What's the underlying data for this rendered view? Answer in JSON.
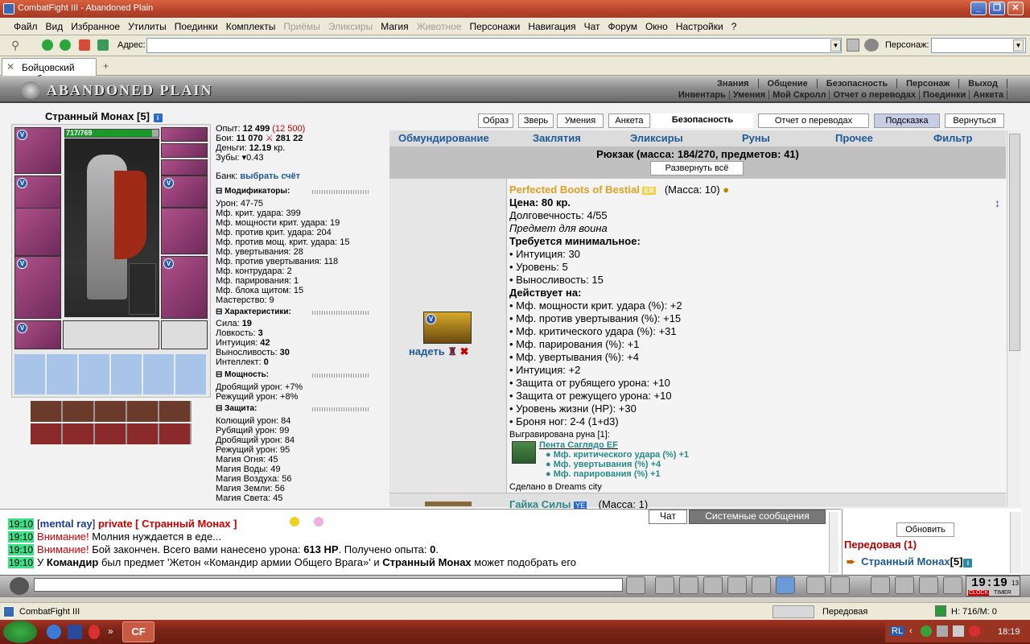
{
  "window": {
    "title": "CombatFight III - Abandoned Plain"
  },
  "menu": [
    {
      "label": "Файл",
      "disabled": false
    },
    {
      "label": "Вид",
      "disabled": false
    },
    {
      "label": "Избранное",
      "disabled": false
    },
    {
      "label": "Утилиты",
      "disabled": false
    },
    {
      "label": "Поединки",
      "disabled": false
    },
    {
      "label": "Комплекты",
      "disabled": false
    },
    {
      "label": "Приёмы",
      "disabled": true
    },
    {
      "label": "Эликсиры",
      "disabled": true
    },
    {
      "label": "Магия",
      "disabled": false
    },
    {
      "label": "Животное",
      "disabled": true
    },
    {
      "label": "Персонажи",
      "disabled": false
    },
    {
      "label": "Навигация",
      "disabled": false
    },
    {
      "label": "Чат",
      "disabled": false
    },
    {
      "label": "Форум",
      "disabled": false
    },
    {
      "label": "Окно",
      "disabled": false
    },
    {
      "label": "Настройки",
      "disabled": false
    },
    {
      "label": "?",
      "disabled": false
    }
  ],
  "toolbar": {
    "address_label": "Адрес:",
    "address_value": "",
    "character_label": "Персонаж:",
    "character_value": ""
  },
  "browser_tab": {
    "label": "Бойцовский клуб"
  },
  "banner": {
    "logo": "ABANDONED PLAIN",
    "nav_top": [
      "Знания",
      "Общение",
      "Безопасность",
      "Персонаж",
      "Выход"
    ],
    "nav_bottom": [
      "Инвентарь",
      "Умения",
      "Мой Скролл",
      "Отчет о переводах",
      "Поединки",
      "Анкета"
    ]
  },
  "character": {
    "name": "Странный Монах",
    "level": "[5]",
    "hp_text": "717/769",
    "hp_fraction": 0.93,
    "experience_label": "Опыт:",
    "experience": "12 499",
    "experience_next": "(12 500)",
    "fights_label": "Бои:",
    "fights": "11 070",
    "wins": "281",
    "losses": "22",
    "money_label": "Деньги:",
    "money": "12.19",
    "money_unit": "кр.",
    "teeth_label": "Зубы:",
    "teeth": "0.43",
    "bank_label": "Банк:",
    "bank_link": "выбрать счёт"
  },
  "sections": {
    "modifiers": {
      "title": "Модификаторы:",
      "rows": [
        "Урон: 47-75",
        "Мф. крит. удара: 399",
        "Мф. мощности крит. удара: 19",
        "Мф. против крит. удара: 204",
        "Мф. против мощ. крит. удара: 15",
        "Мф. увертывания: 28",
        "Мф. против увертывания: 118",
        "Мф. контрудара: 2",
        "Мф. парирования: 1",
        "Мф. блока щитом: 15",
        "Мастерство: 9"
      ]
    },
    "characteristics": {
      "title": "Характеристики:",
      "rows": [
        {
          "label": "Сила:",
          "value": "19"
        },
        {
          "label": "Ловкость:",
          "value": "3"
        },
        {
          "label": "Интуиция:",
          "value": "42"
        },
        {
          "label": "Выносливость:",
          "value": "30"
        },
        {
          "label": "Интеллект:",
          "value": "0"
        }
      ]
    },
    "powers": {
      "title": "Мощность:",
      "rows": [
        "Дробящий урон: +7%",
        "Режущий урон: +8%"
      ]
    },
    "defense": {
      "title": "Защита:",
      "rows": [
        "Колющий урон: 84",
        "Рубящий урон: 99",
        "Дробящий урон: 84",
        "Режущий урон: 95",
        "Магия Огня: 45",
        "Магия Воды: 49",
        "Магия Воздуха: 56",
        "Магия Земли: 56",
        "Магия Света: 45"
      ]
    }
  },
  "top_buttons": [
    "Образ",
    "Зверь",
    "Умения",
    "Анкета",
    "Безопасность",
    "Отчет о переводах",
    "Подсказка",
    "Вернуться"
  ],
  "inventory": {
    "tabs": [
      "Обмундирование",
      "Заклятия",
      "Эликсиры",
      "Руны",
      "Прочее",
      "Фильтр"
    ],
    "backpack": "Рюкзак (масса: 184/270, предметов: 41)",
    "expand_button": "Развернуть всё",
    "item": {
      "name": "Perfected Boots of Bestial",
      "badge": "ER",
      "mass": "(Масса: 10)",
      "wear_link": "надеть",
      "price": "Цена: 80 кр.",
      "durability": "Долговечность: 4/55",
      "for_class": "Предмет для воина",
      "req_title": "Требуется минимальное:",
      "requirements": [
        "• Интуиция: 30",
        "• Уровень: 5",
        "• Выносливость: 15"
      ],
      "effects_title": "Действует на:",
      "effects": [
        "• Мф. мощности крит. удара (%): +2",
        "• Мф. против увертывания (%): +15",
        "• Мф. критического удара (%): +31",
        "• Мф. парирования (%): +1",
        "• Мф. увертывания (%): +4",
        "• Интуиция: +2",
        "• Защита от рубящего урона: +10",
        "• Защита от режущего урона: +10",
        "• Уровень жизни (HP): +30",
        "• Броня ног: 2-4 (1+d3)"
      ],
      "rune_header": "Выгравирована руна [1]:",
      "rune_name": "Пента Саглядо EF",
      "rune_effects": [
        "Мф. критического удара (%) +1",
        "Мф. увертывания (%) +4",
        "Мф. парирования (%) +1"
      ],
      "made_in": "Сделано в Dreams city"
    },
    "next_item": {
      "name": "Гайка Силы",
      "badge": "YE",
      "mass": "(Масса: 1)"
    }
  },
  "chat": {
    "tabs": [
      "Чат",
      "Системные сообщения"
    ],
    "lines": [
      {
        "time": "19:10",
        "parts": [
          {
            "t": "[",
            "c": "#000"
          },
          {
            "t": "mental ray",
            "c": "#1d3a9a",
            "b": true
          },
          {
            "t": "] ",
            "c": "#000"
          },
          {
            "t": "private [ Странный Монах ]",
            "c": "#d00000",
            "b": true
          }
        ]
      },
      {
        "time": "19:10",
        "parts": [
          {
            "t": "Внимание!",
            "c": "#d00000"
          },
          {
            "t": " Молния нуждается в еде...",
            "c": "#000"
          }
        ]
      },
      {
        "time": "19:10",
        "parts": [
          {
            "t": "Внимание!",
            "c": "#d00000"
          },
          {
            "t": " Бой закончен. Всего вами нанесено урона: ",
            "c": "#000"
          },
          {
            "t": "613 HP",
            "c": "#000",
            "b": true
          },
          {
            "t": ". Получено опыта: ",
            "c": "#000"
          },
          {
            "t": "0",
            "c": "#000",
            "b": true
          },
          {
            "t": ".",
            "c": "#000"
          }
        ]
      },
      {
        "time": "19:10",
        "parts": [
          {
            "t": "У ",
            "c": "#000"
          },
          {
            "t": "Командир",
            "c": "#000",
            "b": true
          },
          {
            "t": " был предмет 'Жетон «Командир армии Общего Врага»' и ",
            "c": "#000"
          },
          {
            "t": "Странный Монах",
            "c": "#000",
            "b": true
          },
          {
            "t": " может подобрать его",
            "c": "#000"
          }
        ]
      }
    ]
  },
  "side": {
    "refresh_button": "Обновить",
    "location": "Передовая (1)",
    "player": "Странный Монах",
    "player_level": "[5]"
  },
  "clock": {
    "time": "19:19",
    "seconds": "13",
    "clock_label": "CLOCK",
    "timer_label": "TIMER"
  },
  "statusbar": {
    "left": "CombatFight III",
    "location": "Передовая",
    "counter": "Н: 716/М: 0"
  },
  "taskbar": {
    "lang": "RL",
    "time": "18:19",
    "app": "CF"
  }
}
